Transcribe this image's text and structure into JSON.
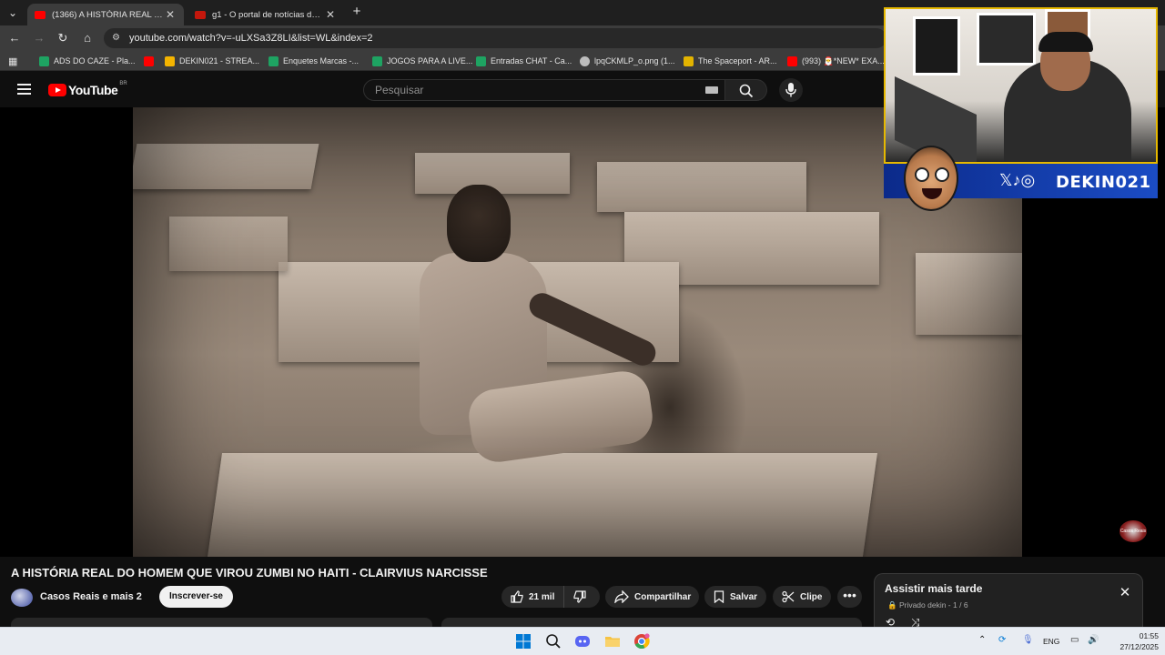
{
  "browser": {
    "tabs": [
      {
        "title": "(1366) A HISTÓRIA REAL DO HOMEM",
        "favicon_color": "#ff0000",
        "active": true
      },
      {
        "title": "g1 - O portal de notícias da Globo",
        "favicon_color": "#c4170c",
        "active": false
      }
    ],
    "tab_close_glyph": "✕",
    "new_tab_glyph": "+",
    "tab_list_glyph": "⌄",
    "url": "youtube.com/watch?v=-uLXSa3Z8LI&list=WL&index=2",
    "bookmarks": [
      {
        "label": "ADS DO CAZE - Pla...",
        "icon_color": "#1ea362"
      },
      {
        "label": "",
        "icon_color": "#ff0000"
      },
      {
        "label": "DEKIN021 - STREA...",
        "icon_color": "#f4b400"
      },
      {
        "label": "Enquetes Marcas -...",
        "icon_color": "#1ea362"
      },
      {
        "label": "JOGOS PARA A LIVE...",
        "icon_color": "#1ea362"
      },
      {
        "label": "Entradas CHAT - Ca...",
        "icon_color": "#1ea362"
      },
      {
        "label": "lpqCKMLP_o.png (1...",
        "icon_color": "#bdbdbd"
      },
      {
        "label": "The Spaceport - AR...",
        "icon_color": "#e3b400"
      },
      {
        "label": "(993) 🎅*NEW* EXA...",
        "icon_color": "#ff0000"
      }
    ]
  },
  "youtube": {
    "logo_text": "YouTube",
    "region": "BR",
    "search_placeholder": "Pesquisar",
    "video_title": "A HISTÓRIA REAL DO HOMEM QUE VIROU ZUMBI NO HAITI - CLAIRVIUS NARCISSE",
    "channel_name": "Casos Reais e mais 2",
    "subscribe_label": "Inscrever-se",
    "like_count": "21 mil",
    "share_label": "Compartilhar",
    "save_label": "Salvar",
    "clip_label": "Clipe",
    "more_glyph": "•••",
    "watermark_text": "Casos Reais",
    "playlist": {
      "title": "Assistir mais tarde",
      "meta": "🔒 Privado dekin - 1 / 6",
      "close_glyph": "✕",
      "loop_glyph": "⟲",
      "shuffle_glyph": "⤨"
    }
  },
  "stream_overlay": {
    "social_icons": "𝕏♪◎",
    "handle": "DEKIN021"
  },
  "taskbar": {
    "apps": [
      {
        "name": "windows-start-icon",
        "color": "#0078d4"
      },
      {
        "name": "search-icon",
        "color": "#1b1b1b"
      },
      {
        "name": "discord-icon",
        "color": "#5865f2"
      },
      {
        "name": "file-explorer-icon",
        "color": "#f6c344"
      },
      {
        "name": "chrome-icon",
        "color": "#34a853"
      }
    ],
    "tray_chevron": "⌃",
    "language": "ENG",
    "time": "01:55",
    "date": "27/12/2025"
  }
}
